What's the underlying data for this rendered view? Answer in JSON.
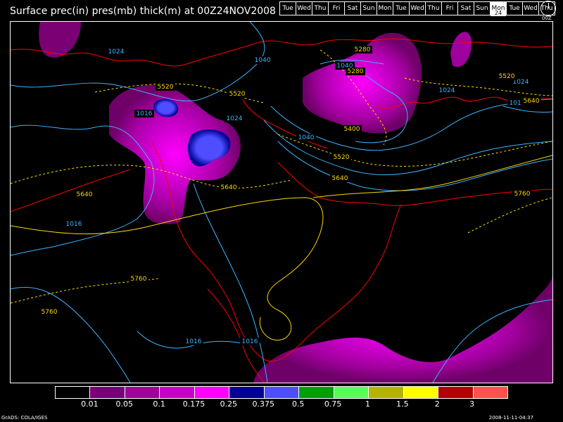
{
  "title": "Surface prec(in) pres(mb) thick(m) at 00Z24NOV2008",
  "days": [
    "Tue",
    "Wed",
    "Thu",
    "Fri",
    "Sat",
    "Sun",
    "Mon",
    "Tue",
    "Wed",
    "Thu",
    "Fri",
    "Sat",
    "Sun",
    "Mon",
    "Tue",
    "Wed",
    "Thu"
  ],
  "current_day_index": 13,
  "current_day_number": "24",
  "clock_label": "00Z",
  "legend": {
    "colors": [
      "#000000",
      "#7a0073",
      "#a0009c",
      "#c800c8",
      "#ff00ff",
      "#000096",
      "#4e4eff",
      "#00a000",
      "#55ff55",
      "#b4b400",
      "#ffff00",
      "#b40000",
      "#ff5050"
    ],
    "ticks": [
      "0.01",
      "0.05",
      "0.1",
      "0.175",
      "0.25",
      "0.375",
      "0.5",
      "0.75",
      "1",
      "1.5",
      "2",
      "3"
    ]
  },
  "contour_labels": {
    "pressure": [
      "1024",
      "1016",
      "1024",
      "1040",
      "1040",
      "1024",
      "1016",
      "1016",
      "1016",
      "1016",
      "1040",
      "1024"
    ],
    "thickness": [
      "5520",
      "5520",
      "5280",
      "5280",
      "5400",
      "5520",
      "5640",
      "5640",
      "5640",
      "5760",
      "5760",
      "5760",
      "5520",
      "5640"
    ]
  },
  "colors": {
    "pressure_contour": "#3cb4ff",
    "thickness_contour": "#ffd700",
    "coastline": "#ff0000",
    "background": "#000000"
  },
  "footer": {
    "left": "GrADS: COLA/IGES",
    "right": "2008-11-11-04:37"
  }
}
